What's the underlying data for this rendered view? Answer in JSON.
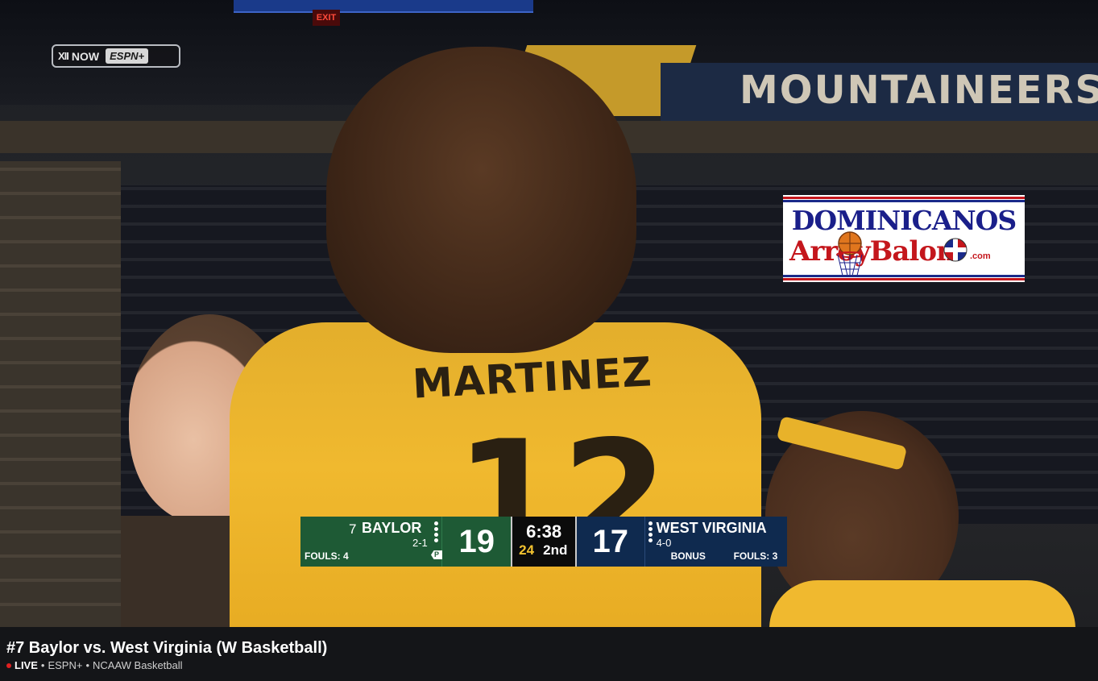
{
  "video": {
    "exit_sign": "EXIT",
    "arena_banner": "MOUNTAINEERS",
    "jersey_name": "MARTINEZ",
    "jersey_number": "12"
  },
  "network_badge": {
    "conference": "XII",
    "now": "NOW",
    "network": "ESPN+"
  },
  "watermark": {
    "line1": "DOMINICANOS",
    "line2": "ArroyBalon",
    "suffix": ".com"
  },
  "scorebug": {
    "away": {
      "rank": "7",
      "name": "BAYLOR",
      "record": "2-1",
      "score": "19",
      "fouls": "FOULS: 4",
      "timeouts_remaining": 4,
      "possession_marker": "P",
      "color": "#1e5a35"
    },
    "clock": {
      "time": "6:38",
      "shot_clock": "24",
      "period": "2nd"
    },
    "home": {
      "name": "WEST VIRGINIA",
      "record": "4-0",
      "score": "17",
      "bonus": "BONUS",
      "fouls": "FOULS: 3",
      "timeouts_remaining": 4,
      "color": "#0f2a4f"
    }
  },
  "info": {
    "title": "#7 Baylor vs. West Virginia (W Basketball)",
    "live": "LIVE",
    "separator": "•",
    "network": "ESPN+",
    "league": "NCAAW Basketball"
  }
}
